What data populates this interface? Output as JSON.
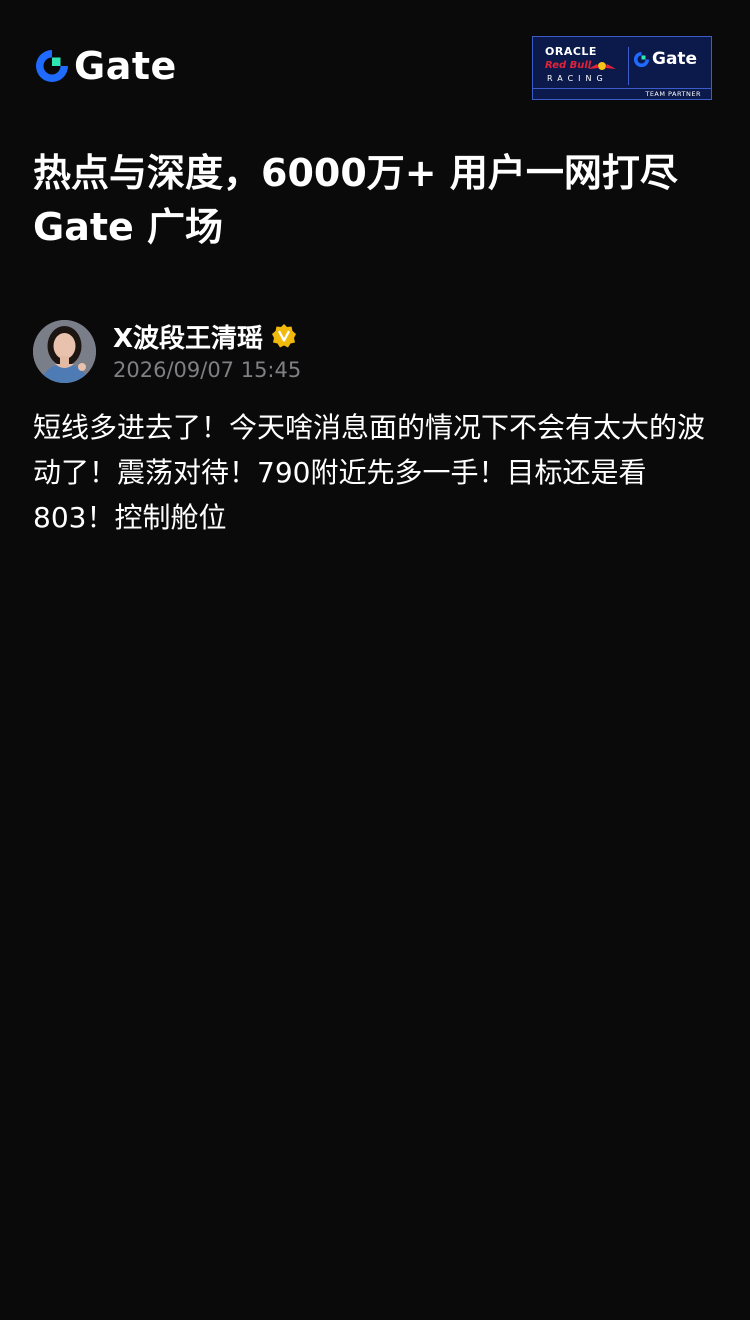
{
  "brand": {
    "logo_text": "Gate",
    "logo_icon": "gate-logo-icon",
    "primary_color": "#1f6bff",
    "accent_color": "#2ee6b4"
  },
  "partner_badge": {
    "line1": "ORACLE",
    "line2": "Red Bull",
    "line3": "RACING",
    "gate_text": "Gate",
    "footer": "TEAM PARTNER"
  },
  "headline": {
    "text": "热点与深度，6000万+ 用户一网打尽 Gate 广场"
  },
  "post": {
    "author_name": "X波段王清瑶",
    "verified_icon": "verified-badge-icon",
    "verified_color": "#f0b90b",
    "timestamp": "2026/09/07 15:45",
    "body": "短线多进去了！今天啥消息面的情况下不会有太大的波动了！震荡对待！790附近先多一手！目标还是看803！控制舱位"
  }
}
